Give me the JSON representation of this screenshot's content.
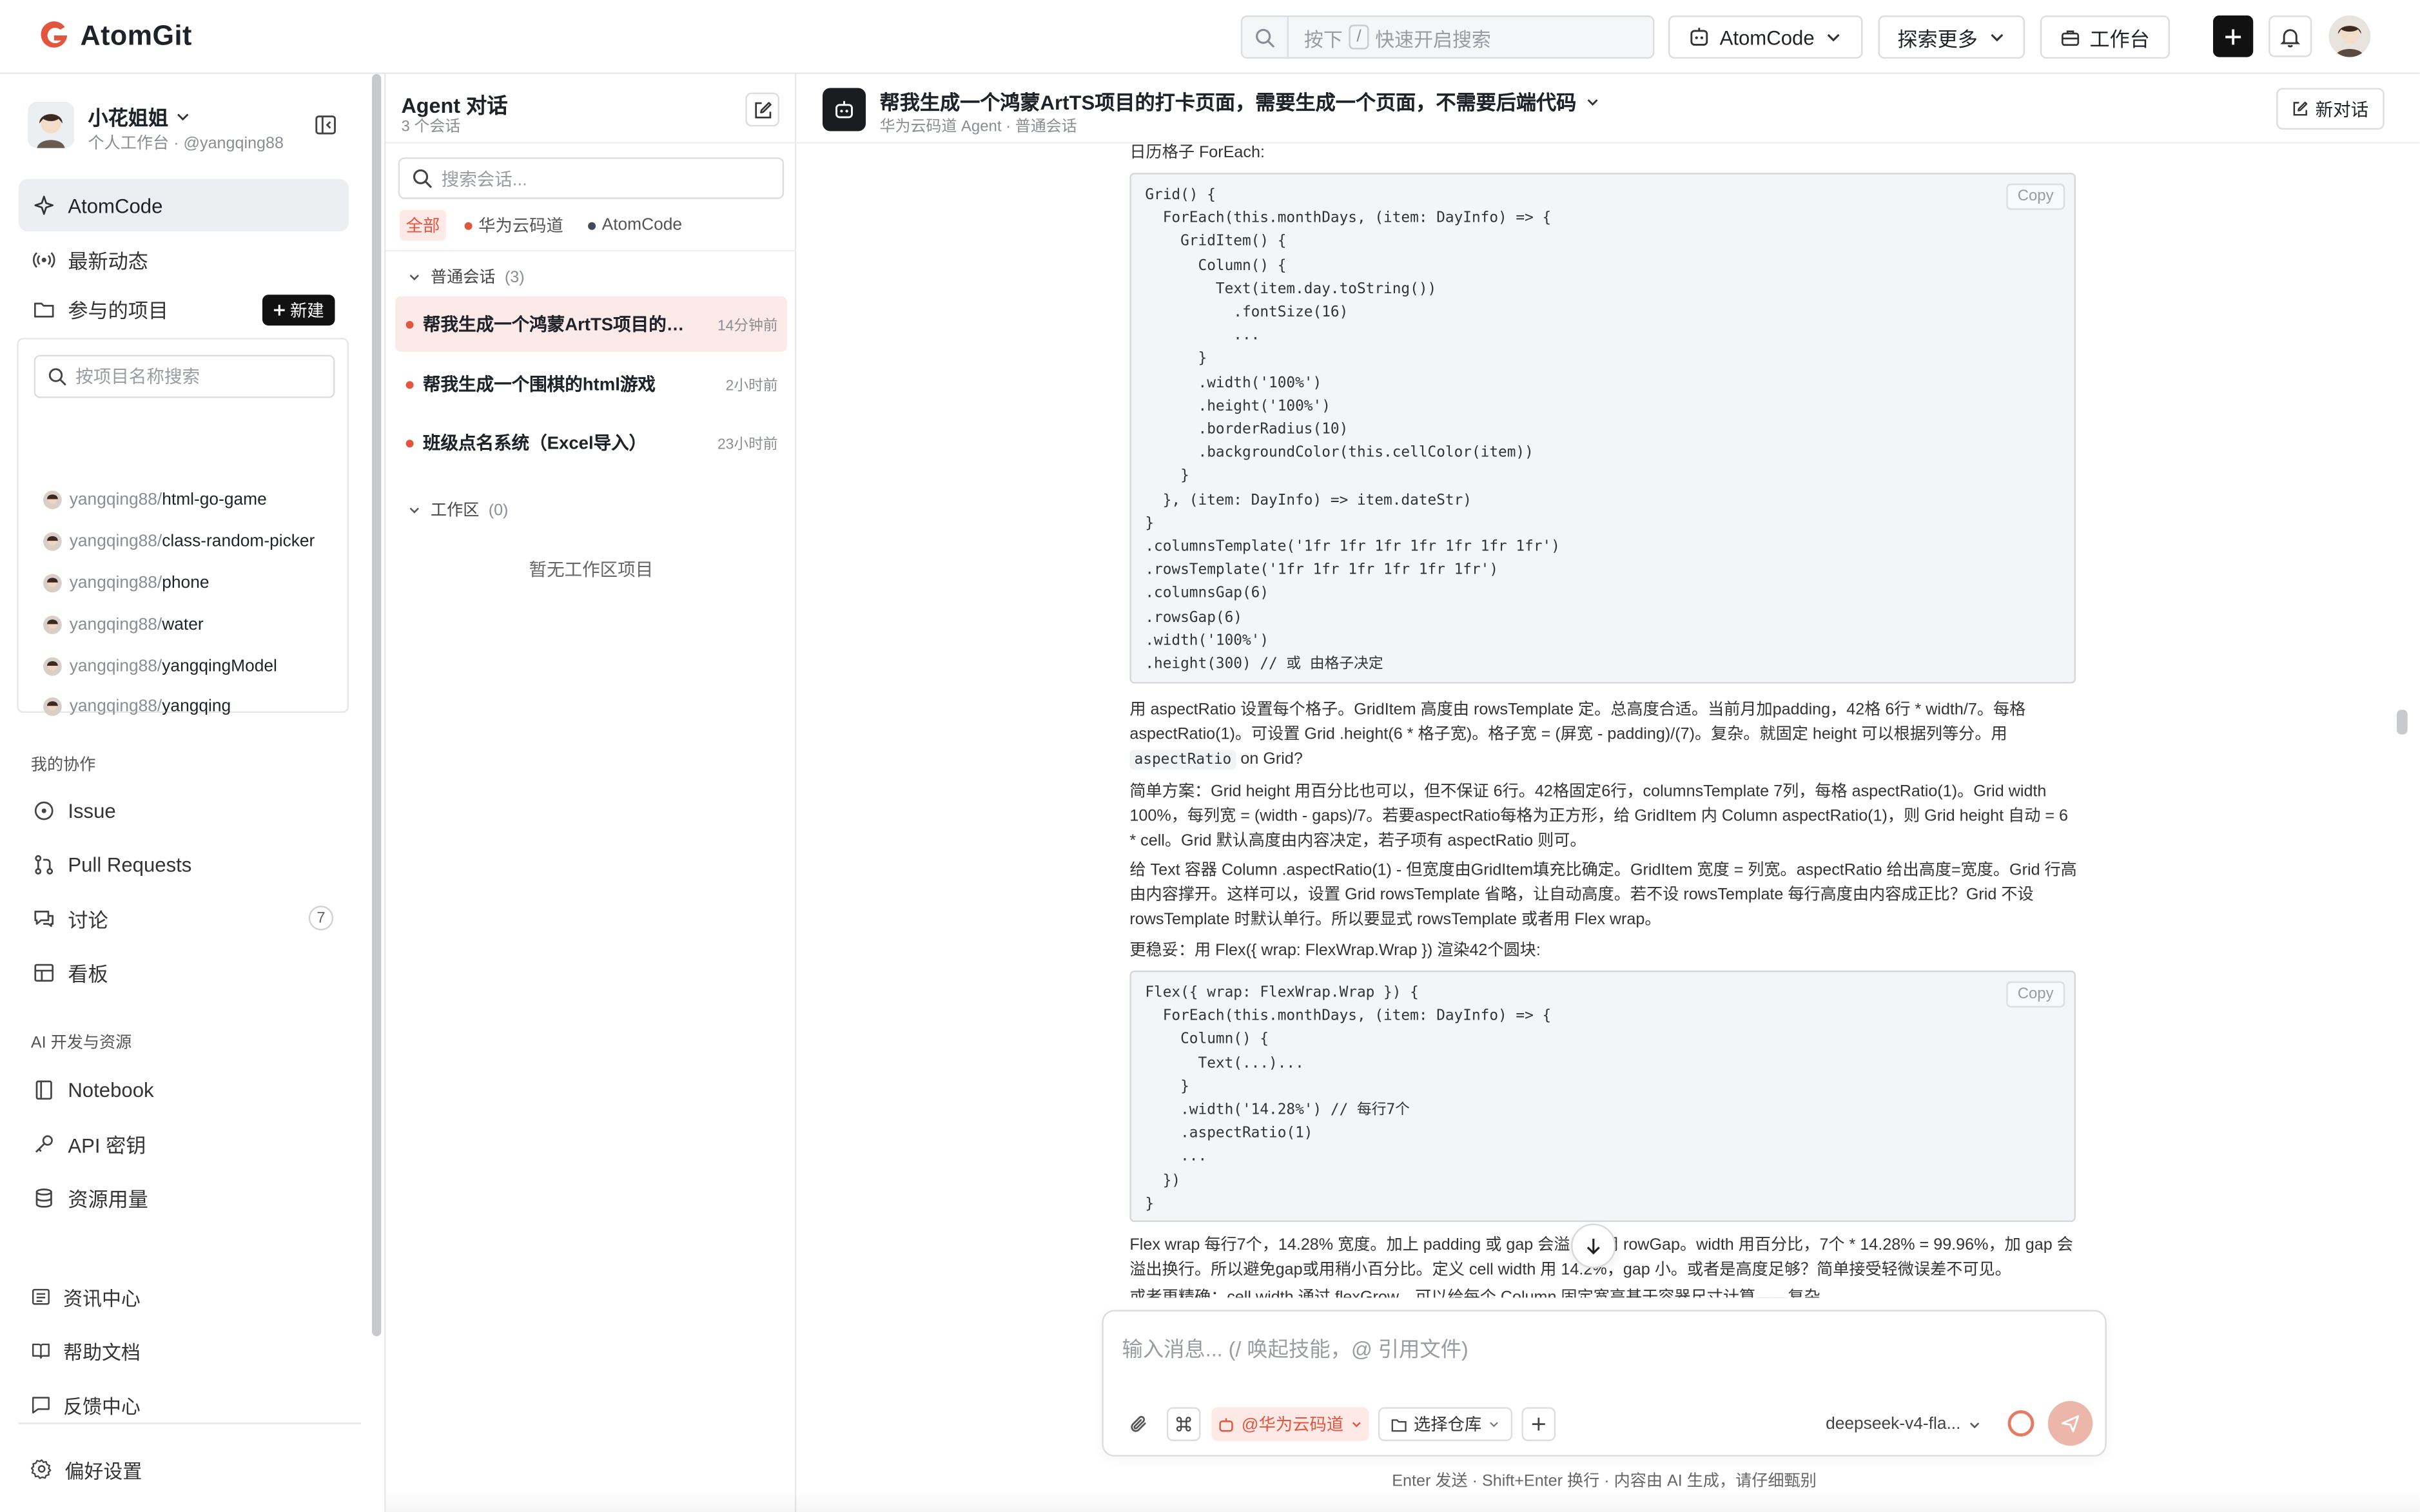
{
  "app": {
    "name": "AtomGit",
    "brand_color": "#e2553f"
  },
  "topbar": {
    "search": {
      "prefix": "按下",
      "key": "/",
      "suffix": "快速开启搜索"
    },
    "atomcode_label": "AtomCode",
    "explore_label": "探索更多",
    "workbench_label": "工作台"
  },
  "user": {
    "name": "小花姐姐",
    "subtitle": "个人工作台 · @yangqing88"
  },
  "nav": {
    "atomcode": "AtomCode",
    "activity": "最新动态",
    "projects": "参与的项目",
    "new_label": "新建",
    "project_search_placeholder": "按项目名称搜索",
    "projects_list": [
      {
        "owner": "yangqing88/",
        "repo": "html-go-game"
      },
      {
        "owner": "yangqing88/",
        "repo": "class-random-picker"
      },
      {
        "owner": "yangqing88/",
        "repo": "phone"
      },
      {
        "owner": "yangqing88/",
        "repo": "water"
      },
      {
        "owner": "yangqing88/",
        "repo": "yangqingModel"
      },
      {
        "owner": "yangqing88/",
        "repo": "yangqing"
      }
    ],
    "collab_header": "我的协作",
    "issue": "Issue",
    "pull_requests": "Pull Requests",
    "discussion": "讨论",
    "discussion_count": "7",
    "board": "看板",
    "ai_header": "AI 开发与资源",
    "notebook": "Notebook",
    "api_key": "API 密钥",
    "usage": "资源用量",
    "news": "资讯中心",
    "help": "帮助文档",
    "feedback": "反馈中心",
    "settings": "偏好设置"
  },
  "agent_panel": {
    "title": "Agent 对话",
    "count": "3 个会话",
    "search_placeholder": "搜索会话...",
    "filters": [
      {
        "label": "全部",
        "color": ""
      },
      {
        "label": "华为云码道",
        "color": "#e2553f"
      },
      {
        "label": "AtomCode",
        "color": "#3f4a5a"
      }
    ],
    "group_normal": {
      "label": "普通会话",
      "count": "(3)"
    },
    "conversations": [
      {
        "title": "帮我生成一个鸿蒙ArtTS项目的打卡...",
        "time": "14分钟前"
      },
      {
        "title": "帮我生成一个围棋的html游戏",
        "time": "2小时前"
      },
      {
        "title": "班级点名系统（Excel导入）",
        "time": "23小时前"
      }
    ],
    "group_workspace": {
      "label": "工作区",
      "count": "(0)"
    },
    "workspace_empty": "暂无工作区项目"
  },
  "chat": {
    "title": "帮我生成一个鸿蒙ArtTS项目的打卡页面，需要生成一个页面，不需要后端代码",
    "subtitle": "华为云码道 Agent · 普通会话",
    "new_chat_label": "新对话",
    "copy_label": "Copy",
    "intro": "日历格子 ForEach:",
    "code1": "Grid() {\n  ForEach(this.monthDays, (item: DayInfo) => {\n    GridItem() {\n      Column() {\n        Text(item.day.toString())\n          .fontSize(16)\n          ...\n      }\n      .width('100%')\n      .height('100%')\n      .borderRadius(10)\n      .backgroundColor(this.cellColor(item))\n    }\n  }, (item: DayInfo) => item.dateStr)\n}\n.columnsTemplate('1fr 1fr 1fr 1fr 1fr 1fr 1fr')\n.rowsTemplate('1fr 1fr 1fr 1fr 1fr 1fr')\n.columnsGap(6)\n.rowsGap(6)\n.width('100%')\n.height(300) // 或 由格子决定",
    "p1a": "用 aspectRatio 设置每个格子。GridItem 高度由 rowsTemplate 定。总高度合适。当前月加padding，42格 6行 * width/7。每格 aspectRatio(1)。可设置 Grid .height(6 * 格子宽)。格子宽 = (屏宽 - padding)/(7)。复杂。就固定 height 可以根据列等分。用",
    "p1code": "aspectRatio",
    "p1b": " on Grid?",
    "p2": "简单方案：Grid height 用百分比也可以，但不保证 6行。42格固定6行，columnsTemplate 7列，每格 aspectRatio(1)。Grid width 100%，每列宽 = (width - gaps)/7。若要aspectRatio每格为正方形，给 GridItem 内 Column aspectRatio(1)，则 Grid height 自动 = 6 * cell。Grid 默认高度由内容决定，若子项有 aspectRatio 则可。",
    "p3": "给 Text 容器 Column .aspectRatio(1) - 但宽度由GridItem填充比确定。GridItem 宽度 = 列宽。aspectRatio 给出高度=宽度。Grid 行高由内容撑开。这样可以，设置 Grid rowsTemplate 省略，让自动高度。若不设 rowsTemplate 每行高度由内容成正比？Grid 不设 rowsTemplate 时默认单行。所以要显式 rowsTemplate 或者用 Flex wrap。",
    "p4": "更稳妥：用 Flex({ wrap: FlexWrap.Wrap }) 渲染42个圆块:",
    "code2": "Flex({ wrap: FlexWrap.Wrap }) {\n  ForEach(this.monthDays, (item: DayInfo) => {\n    Column() {\n      Text(...)...\n    }\n    .width('14.28%') // 每行7个\n    .aspectRatio(1)\n    ...\n  })\n}",
    "p5": "Flex wrap 每行7个，14.28% 宽度。加上 padding 或 gap 会溢出。用 rowGap。width 用百分比，7个 * 14.28% = 99.96%，加 gap 会溢出换行。所以避免gap或用稍小百分比。定义 cell width 用 14.2%，gap 小。或者是高度足够？简单接受轻微误差不可见。",
    "p6": "或者更精确：cell width 通过 flexGrow，可以给每个 Column 固定宽高基于容器尺寸计算——复杂。",
    "input_placeholder": "输入消息...  (/ 唤起技能，@ 引用文件)",
    "agent_tag": "@华为云码道",
    "repo_select": "选择仓库",
    "model": "deepseek-v4-fla...",
    "hint": "Enter 发送 · Shift+Enter 换行 · 内容由 AI 生成，请仔细甄别"
  }
}
